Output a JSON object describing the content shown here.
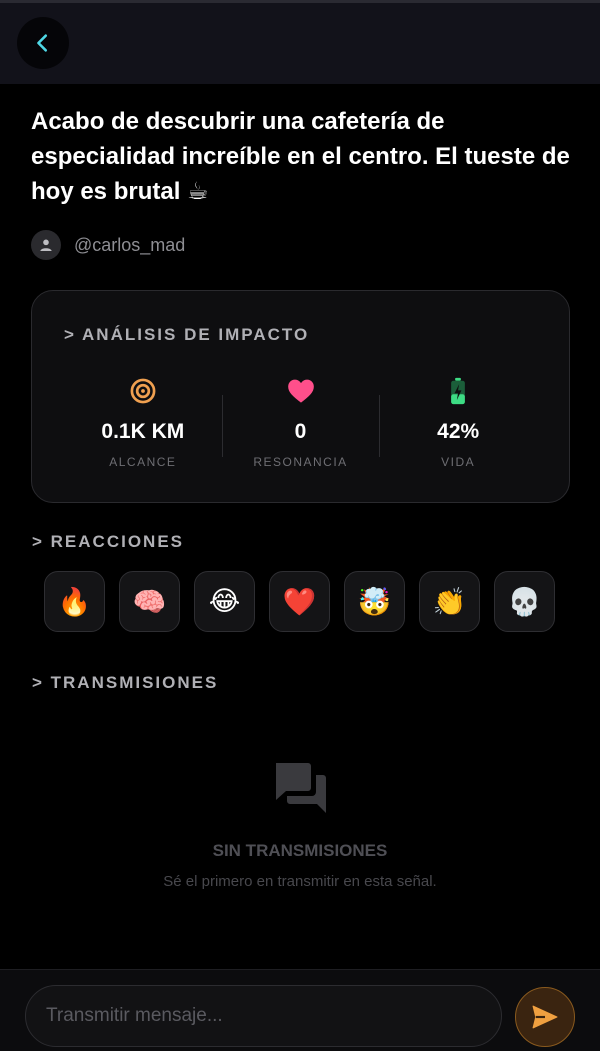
{
  "header": {
    "back_icon": "chevron-left-icon",
    "accent": "#4fd8e6"
  },
  "post": {
    "title": "Acabo de descubrir una cafetería de especialidad increíble en el centro. El tueste de hoy es brutal ☕",
    "author": "@carlos_mad"
  },
  "impact": {
    "heading": "> ANÁLISIS DE IMPACTO",
    "metrics": [
      {
        "icon": "target-icon",
        "value": "0.1K KM",
        "label": "ALCANCE",
        "color": "#f0a050"
      },
      {
        "icon": "heart-icon",
        "value": "0",
        "label": "RESONANCIA",
        "color": "#ff4f8b"
      },
      {
        "icon": "battery-charging-icon",
        "value": "42%",
        "label": "VIDA",
        "color": "#3ddc84",
        "level": 0.42
      }
    ]
  },
  "reactions": {
    "heading": "> REACCIONES",
    "items": [
      "🔥",
      "🧠",
      "😂",
      "❤️",
      "🤯",
      "👏",
      "💀"
    ]
  },
  "transmissions": {
    "heading": "> TRANSMISIONES",
    "empty_title": "SIN TRANSMISIONES",
    "empty_subtitle": "Sé el primero en transmitir en esta señal."
  },
  "composer": {
    "placeholder": "Transmitir mensaje...",
    "value": "",
    "send_color": "#f0a040"
  }
}
